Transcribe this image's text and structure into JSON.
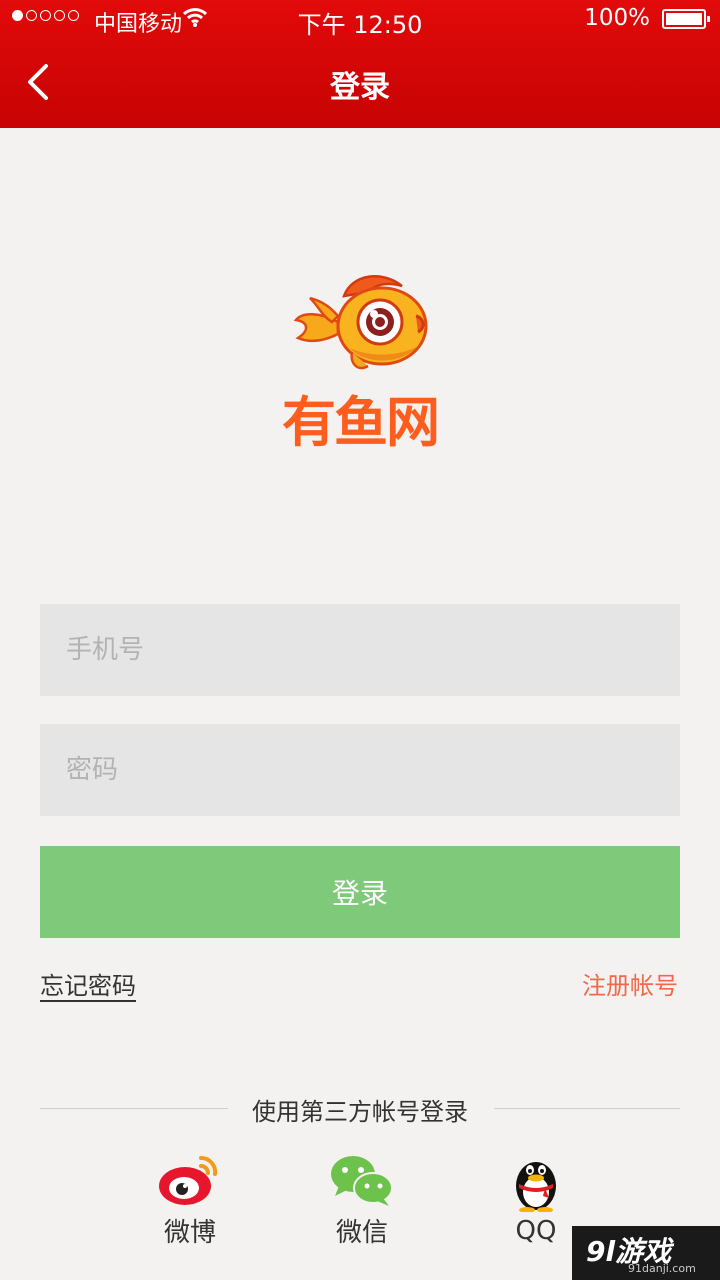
{
  "status_bar": {
    "carrier": "中国移动",
    "time": "下午 12:50",
    "battery": "100%"
  },
  "header": {
    "title": "登录"
  },
  "logo": {
    "text": "有鱼网"
  },
  "form": {
    "phone_placeholder": "手机号",
    "password_placeholder": "密码",
    "login_label": "登录",
    "forgot_label": "忘记密码",
    "register_label": "注册帐号"
  },
  "third_party": {
    "title": "使用第三方帐号登录",
    "items": [
      {
        "label": "微博",
        "icon": "weibo-icon"
      },
      {
        "label": "微信",
        "icon": "wechat-icon"
      },
      {
        "label": "QQ",
        "icon": "qq-icon"
      }
    ]
  },
  "watermark": {
    "text": "9l游戏",
    "url": "91danji.com"
  },
  "colors": {
    "header": "#d90606",
    "login_button": "#7fc97a",
    "register_link": "#f0694a",
    "logo": "#ff5d1e"
  }
}
